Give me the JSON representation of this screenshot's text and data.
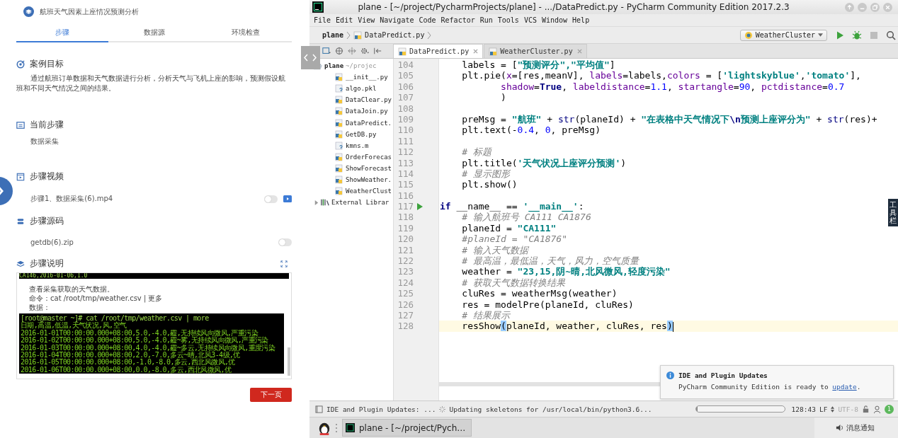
{
  "left_panel": {
    "title": "航班天气因素上座情况预测分析",
    "tabs": [
      {
        "label": "步骤",
        "selected": true
      },
      {
        "label": "数据源",
        "selected": false
      },
      {
        "label": "环境检查",
        "selected": false
      }
    ],
    "goal": {
      "heading": "案例目标",
      "text": "通过航班订单数据和天气数据进行分析，分析天气与飞机上座的影响，预测假设航班和不同天气情况之间的结果。"
    },
    "current_step": {
      "heading": "当前步骤",
      "value": "数据采集"
    },
    "video": {
      "heading": "步骤视频",
      "file": "步骤1、数据采集(6).mp4",
      "on": false
    },
    "source": {
      "heading": "步骤源码",
      "file": "getdb(6).zip",
      "on": false
    },
    "description": {
      "heading": "步骤说明",
      "terminal_top": "CA146,2016-01-06,1.0",
      "lines": [
        "查看采集获取的天气数据。",
        "命令：cat /root/tmp/weather.csv | 更多",
        "数据："
      ],
      "terminal": [
        "[root@master ~]# cat /root/tmp/weather.csv | more",
        "日期,高温,低温,天气状况,风,空气",
        "2016-01-01T00:00:00.000+08:00,5.0,-4.0,霾,无持续风向微风,严重污染",
        "2016-01-02T00:00:00.000+08:00,5.0,-4.0,霾~雾,无持续风向微风,严重污染",
        "2016-01-03T00:00:00.000+08:00,4.0,-4.0,霾~多云,无持续风向微风,重度污染",
        "2016-01-04T00:00:00.000+08:00,2.0,-7.0,多云~晴,北风3-4级,优",
        "2016-01-05T00:00:00.000+08:00,-1.0,-8.0,多云,西北风微风,优",
        "2016-01-06T00:00:00.000+08:00,0.0,-8.0,多云,西北风微风,优"
      ]
    },
    "next_button": "下一页"
  },
  "ide": {
    "title": "plane - [~/project/PycharmProjects/plane] - .../DataPredict.py - PyCharm Community Edition 2017.2.3",
    "menu": [
      "File",
      "Edit",
      "View",
      "Navigate",
      "Code",
      "Refactor",
      "Run",
      "Tools",
      "VCS",
      "Window",
      "Help"
    ],
    "breadcrumbs": [
      "plane",
      "DataPredict.py"
    ],
    "run_config": "WeatherCluster",
    "tabs": [
      {
        "label": "DataPredict.py",
        "selected": true
      },
      {
        "label": "WeatherCluster.py",
        "selected": false
      }
    ],
    "project_tree": [
      {
        "label": "plane",
        "path": "~/projec",
        "kind": "folder",
        "expanded": true,
        "children": [
          {
            "label": "__init__.py",
            "kind": "python"
          },
          {
            "label": "algo.pkl",
            "kind": "unknown"
          },
          {
            "label": "DataClear.py",
            "kind": "python"
          },
          {
            "label": "DataJoin.py",
            "kind": "python"
          },
          {
            "label": "DataPredict.",
            "kind": "python"
          },
          {
            "label": "GetDB.py",
            "kind": "python"
          },
          {
            "label": "kmns.m",
            "kind": "unknown"
          },
          {
            "label": "OrderForecas",
            "kind": "python"
          },
          {
            "label": "ShowForecast",
            "kind": "python"
          },
          {
            "label": "ShowWeather.",
            "kind": "python"
          },
          {
            "label": "WeatherClust",
            "kind": "python"
          }
        ]
      },
      {
        "label": "External Librar",
        "kind": "library",
        "expanded": false
      }
    ],
    "code_lines": [
      {
        "number": "104",
        "current": false,
        "tokens": [
          {
            "text": "    labels = [",
            "kind": "plain"
          },
          {
            "text": "\"预测评分\",\"平均值\"",
            "kind": "string"
          },
          {
            "text": "]",
            "kind": "plain"
          }
        ]
      },
      {
        "number": "105",
        "current": false,
        "tokens": [
          {
            "text": "    plt.pie(",
            "kind": "plain"
          },
          {
            "text": "x",
            "kind": "param"
          },
          {
            "text": "=[res,meanV], ",
            "kind": "plain"
          },
          {
            "text": "labels",
            "kind": "param"
          },
          {
            "text": "=labels,",
            "kind": "plain"
          },
          {
            "text": "colors",
            "kind": "param"
          },
          {
            "text": " = [",
            "kind": "plain"
          },
          {
            "text": "'lightskyblue'",
            "kind": "string"
          },
          {
            "text": ",",
            "kind": "plain"
          },
          {
            "text": "'tomato'",
            "kind": "string"
          },
          {
            "text": "],",
            "kind": "plain"
          }
        ]
      },
      {
        "number": "106",
        "current": false,
        "tokens": [
          {
            "text": "           shadow",
            "kind": "param"
          },
          {
            "text": "=",
            "kind": "plain"
          },
          {
            "text": "True",
            "kind": "keyword"
          },
          {
            "text": ", ",
            "kind": "plain"
          },
          {
            "text": "labeldistance",
            "kind": "param"
          },
          {
            "text": "=",
            "kind": "plain"
          },
          {
            "text": "1.1",
            "kind": "number"
          },
          {
            "text": ", ",
            "kind": "plain"
          },
          {
            "text": "startangle",
            "kind": "param"
          },
          {
            "text": "=",
            "kind": "plain"
          },
          {
            "text": "90",
            "kind": "number"
          },
          {
            "text": ", ",
            "kind": "plain"
          },
          {
            "text": "pctdistance",
            "kind": "param"
          },
          {
            "text": "=",
            "kind": "plain"
          },
          {
            "text": "0.7",
            "kind": "number"
          }
        ]
      },
      {
        "number": "107",
        "current": false,
        "tokens": [
          {
            "text": "           )",
            "kind": "plain"
          }
        ]
      },
      {
        "number": "108",
        "current": false
      },
      {
        "number": "109",
        "current": false,
        "tokens": [
          {
            "text": "    preMsg = ",
            "kind": "plain"
          },
          {
            "text": "\"航班\"",
            "kind": "string"
          },
          {
            "text": " + ",
            "kind": "plain"
          },
          {
            "text": "str",
            "kind": "builtin"
          },
          {
            "text": "(planeId) + ",
            "kind": "plain"
          },
          {
            "text": "\"在表格中天气情况下",
            "kind": "string"
          },
          {
            "text": "\\n",
            "kind": "escape"
          },
          {
            "text": "预测上座评分为\"",
            "kind": "string"
          },
          {
            "text": " + ",
            "kind": "plain"
          },
          {
            "text": "str",
            "kind": "builtin"
          },
          {
            "text": "(res)+",
            "kind": "plain"
          }
        ]
      },
      {
        "number": "110",
        "current": false,
        "tokens": [
          {
            "text": "    plt.text(-",
            "kind": "plain"
          },
          {
            "text": "0.4",
            "kind": "number"
          },
          {
            "text": ", ",
            "kind": "plain"
          },
          {
            "text": "0",
            "kind": "number"
          },
          {
            "text": ", preMsg)",
            "kind": "plain"
          }
        ]
      },
      {
        "number": "111",
        "current": false
      },
      {
        "number": "112",
        "current": false,
        "tokens": [
          {
            "text": "    # 标题",
            "kind": "comment"
          }
        ]
      },
      {
        "number": "113",
        "current": false,
        "tokens": [
          {
            "text": "    plt.title(",
            "kind": "plain"
          },
          {
            "text": "'天气状况上座评分预测'",
            "kind": "string"
          },
          {
            "text": ")",
            "kind": "plain"
          }
        ]
      },
      {
        "number": "114",
        "current": false,
        "tokens": [
          {
            "text": "    # 显示图形",
            "kind": "comment"
          }
        ]
      },
      {
        "number": "115",
        "current": false,
        "tokens": [
          {
            "text": "    plt.show()",
            "kind": "plain"
          }
        ]
      },
      {
        "number": "116",
        "current": false
      },
      {
        "number": "117",
        "current": false,
        "run_marker": true,
        "tokens": [
          {
            "text": "if",
            "kind": "keyword"
          },
          {
            "text": " __name__ == ",
            "kind": "plain"
          },
          {
            "text": "'__main__'",
            "kind": "string"
          },
          {
            "text": ":",
            "kind": "plain"
          }
        ]
      },
      {
        "number": "118",
        "current": false,
        "tokens": [
          {
            "text": "    # 输入航班号 CA111 CA1876",
            "kind": "comment"
          }
        ]
      },
      {
        "number": "119",
        "current": false,
        "tokens": [
          {
            "text": "    planeId = ",
            "kind": "plain"
          },
          {
            "text": "\"CA111\"",
            "kind": "string"
          }
        ]
      },
      {
        "number": "120",
        "current": false,
        "tokens": [
          {
            "text": "    #planeId = \"CA1876\"",
            "kind": "comment"
          }
        ]
      },
      {
        "number": "121",
        "current": false,
        "tokens": [
          {
            "text": "    # 输入天气数据",
            "kind": "comment"
          }
        ]
      },
      {
        "number": "122",
        "current": false,
        "tokens": [
          {
            "text": "    # 最高温，最低温，天气，风力，空气质量",
            "kind": "comment"
          }
        ]
      },
      {
        "number": "123",
        "current": false,
        "tokens": [
          {
            "text": "    weather = ",
            "kind": "plain"
          },
          {
            "text": "\"23,15,阴~晴,北风微风,轻度污染\"",
            "kind": "string"
          }
        ]
      },
      {
        "number": "124",
        "current": false,
        "tokens": [
          {
            "text": "    # 获取天气数据转换结果",
            "kind": "comment"
          }
        ]
      },
      {
        "number": "125",
        "current": false,
        "tokens": [
          {
            "text": "    cluRes = weatherMsg(weather)",
            "kind": "plain"
          }
        ]
      },
      {
        "number": "126",
        "current": false,
        "tokens": [
          {
            "text": "    res = modelPre(planeId, cluRes)",
            "kind": "plain"
          }
        ]
      },
      {
        "number": "127",
        "current": false,
        "tokens": [
          {
            "text": "    # 结果展示",
            "kind": "comment"
          }
        ]
      },
      {
        "number": "128",
        "current": true,
        "tokens": [
          {
            "text": "    resShow",
            "kind": "plain"
          },
          {
            "text": "(",
            "kind": "brace"
          },
          {
            "text": "planeId, weather, cluRes, res",
            "kind": "plain"
          },
          {
            "text": ")",
            "kind": "brace"
          }
        ]
      }
    ],
    "notification": {
      "title": "IDE and Plugin Updates",
      "text": "PyCharm Community Edition is ready to ",
      "link": "update",
      "text_end": "."
    },
    "status_bar": {
      "message": "IDE and Plugin Updates: ...",
      "task": "Updating skeletons for /usr/local/bin/python3.6...",
      "level": 0.02,
      "position": "128:43",
      "line_separator": "LF",
      "encoding": {
        "label": "UTF-8",
        "disabled": true
      },
      "badge": "1"
    },
    "side_tab": "工具栏"
  },
  "taskbar": {
    "task": "plane - [~/project/Pych…",
    "tray": "消息通知"
  }
}
